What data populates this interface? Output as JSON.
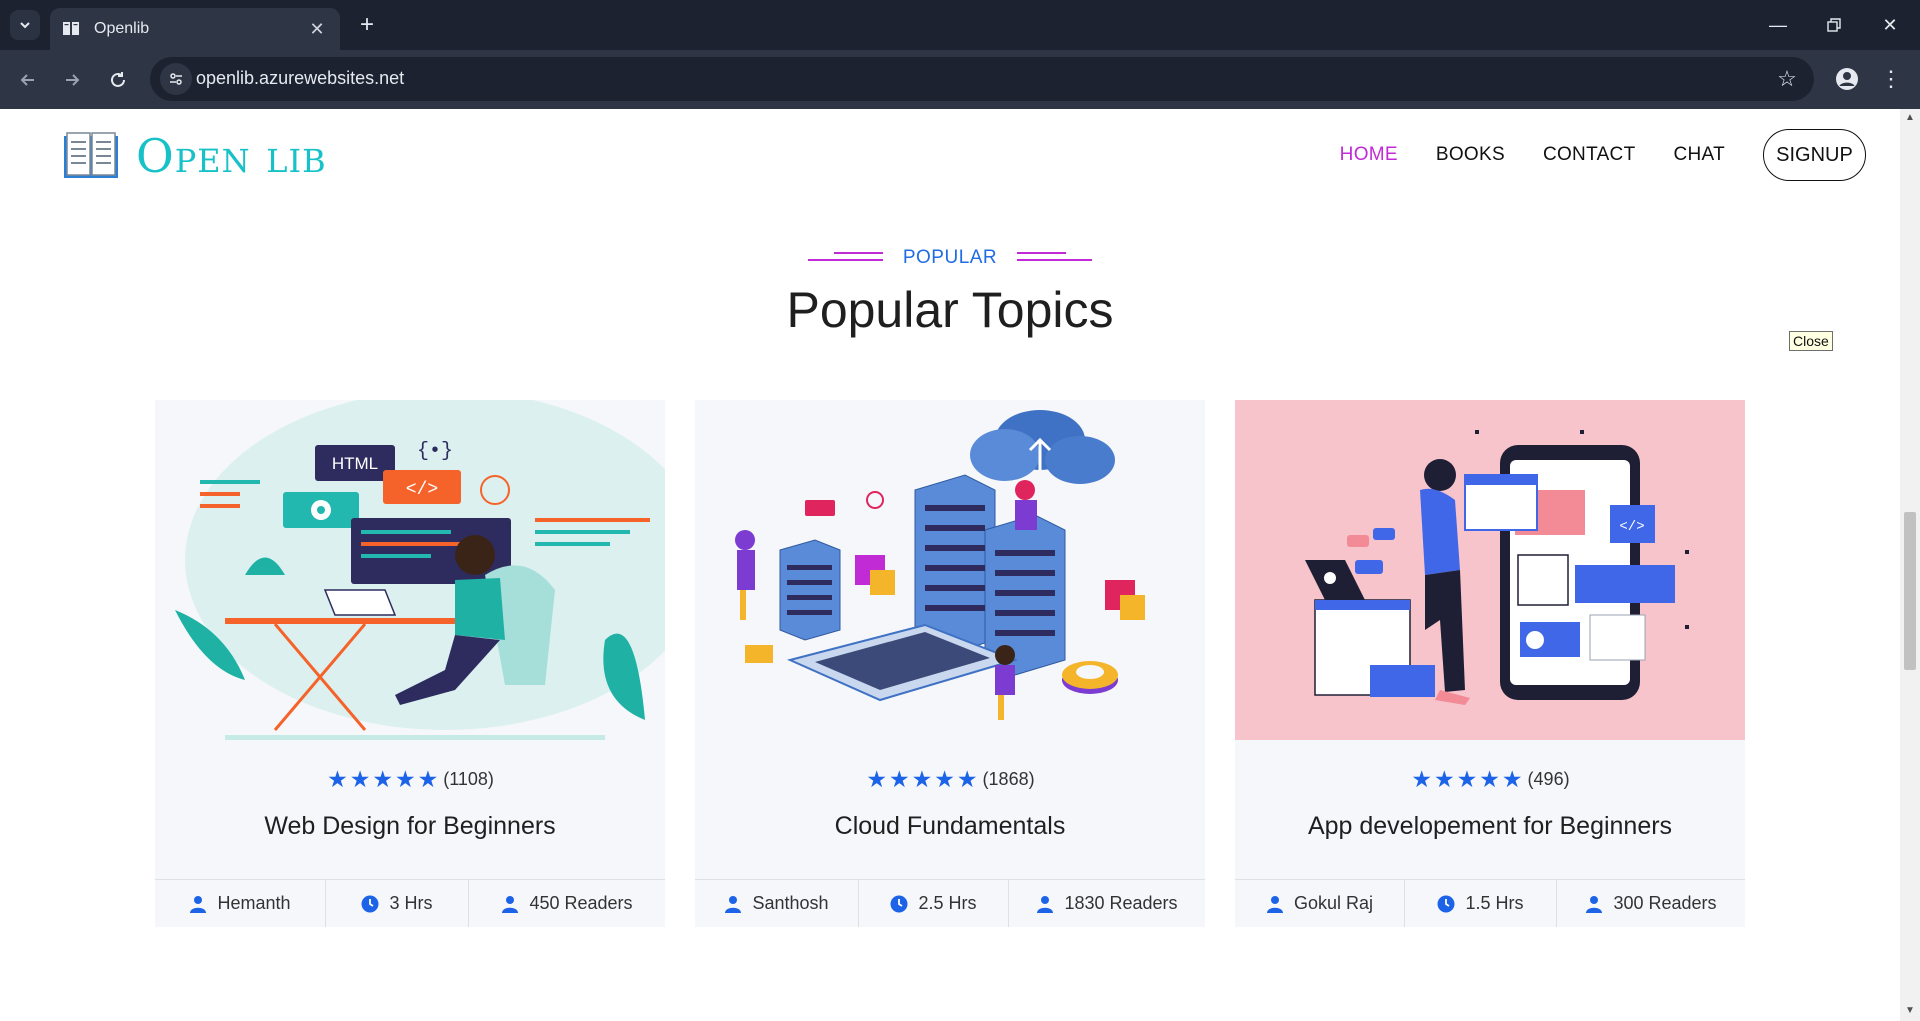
{
  "browser": {
    "tab_title": "Openlib",
    "url": "openlib.azurewebsites.net"
  },
  "site": {
    "logo_text": "Open lib",
    "nav": [
      {
        "label": "HOME",
        "active": true
      },
      {
        "label": "BOOKS",
        "active": false
      },
      {
        "label": "CONTACT",
        "active": false
      },
      {
        "label": "CHAT",
        "active": false
      }
    ],
    "signup_label": "SIGNUP"
  },
  "section": {
    "tag": "POPULAR",
    "title": "Popular Topics"
  },
  "tooltip": "Close",
  "cards": [
    {
      "rating_count": "(1108)",
      "stars": 5,
      "title": "Web Design for Beginners",
      "author": "Hemanth",
      "duration": "3 Hrs",
      "readers": "450 Readers",
      "image": "web-design-illustration"
    },
    {
      "rating_count": "(1868)",
      "stars": 5,
      "title": "Cloud Fundamentals",
      "author": "Santhosh",
      "duration": "2.5 Hrs",
      "readers": "1830 Readers",
      "image": "cloud-illustration"
    },
    {
      "rating_count": "(496)",
      "stars": 5,
      "title": "App developement for Beginners",
      "author": "Gokul Raj",
      "duration": "1.5 Hrs",
      "readers": "300 Readers",
      "image": "app-dev-illustration"
    }
  ],
  "colors": {
    "accent": "#c02bd5",
    "brand": "#17c1c8",
    "blue": "#1d63e8"
  }
}
